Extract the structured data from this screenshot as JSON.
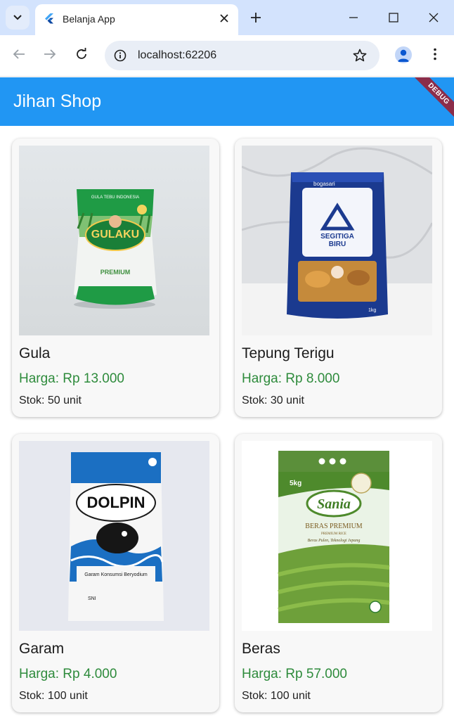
{
  "browser": {
    "tab_title": "Belanja App",
    "url": "localhost:62206"
  },
  "app": {
    "title": "Jihan Shop",
    "debug_label": "DEBUG",
    "primary_color": "#2196f3",
    "price_color": "#2e8b3c"
  },
  "products": [
    {
      "name": "Gula",
      "price": "Harga: Rp 13.000",
      "stock": "Stok: 50 unit"
    },
    {
      "name": "Tepung Terigu",
      "price": "Harga: Rp 8.000",
      "stock": "Stok: 30 unit"
    },
    {
      "name": "Garam",
      "price": "Harga: Rp 4.000",
      "stock": "Stok: 100 unit"
    },
    {
      "name": "Beras",
      "price": "Harga: Rp 57.000",
      "stock": "Stok: 100 unit"
    }
  ],
  "product_images": {
    "gula": {
      "brand": "GULAKU",
      "line1": "GULA TEBU INDONESIA",
      "line2": "PREMIUM"
    },
    "terigu": {
      "brand": "bogasari",
      "line1": "SEGITIGA",
      "line2": "BIRU",
      "weight": "1kg"
    },
    "garam": {
      "brand": "DOLPIN",
      "line1": "Garam Konsumsi Beryodium",
      "reg": "SNI"
    },
    "beras": {
      "brand": "Sania",
      "line1": "BERAS PREMIUM",
      "line2": "PREMIUM RICE",
      "line3": "Beras Pulen, Teknologi Jepang",
      "weight": "5kg"
    }
  }
}
